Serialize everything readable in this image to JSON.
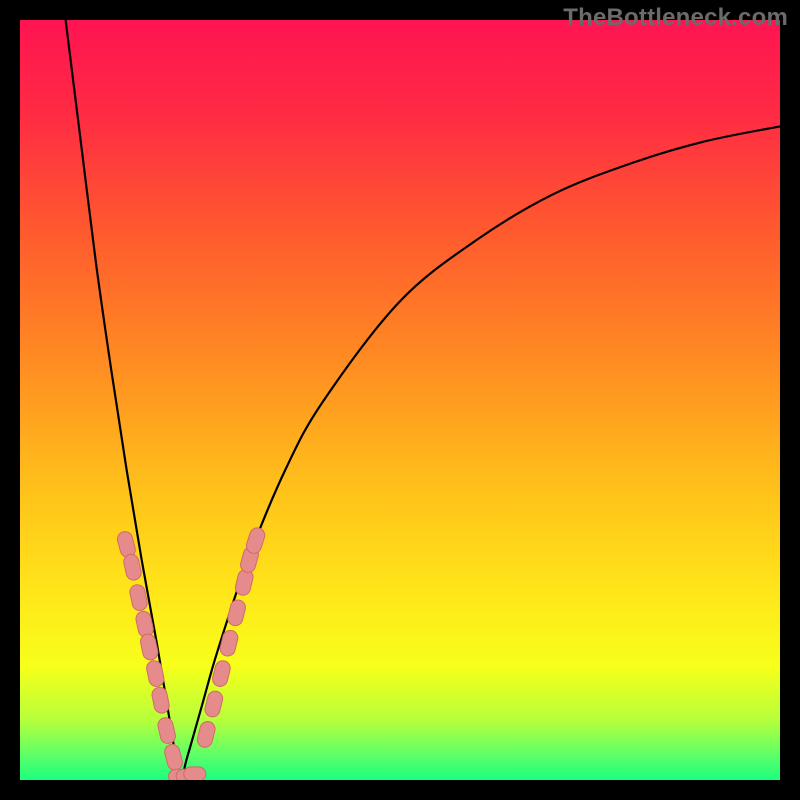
{
  "watermark_text": "TheBottleneck.com",
  "colors": {
    "frame_bg": "#000000",
    "gradient_stops": [
      {
        "offset": 0.0,
        "color": "#ff1452"
      },
      {
        "offset": 0.12,
        "color": "#ff2a44"
      },
      {
        "offset": 0.28,
        "color": "#ff5a2e"
      },
      {
        "offset": 0.45,
        "color": "#ff8c22"
      },
      {
        "offset": 0.62,
        "color": "#ffc21a"
      },
      {
        "offset": 0.76,
        "color": "#ffe81a"
      },
      {
        "offset": 0.85,
        "color": "#f7ff1a"
      },
      {
        "offset": 0.92,
        "color": "#b8ff3a"
      },
      {
        "offset": 0.97,
        "color": "#58ff6a"
      },
      {
        "offset": 1.0,
        "color": "#1aff80"
      }
    ],
    "curve_stroke": "#000000",
    "marker_fill": "#e58b8b",
    "marker_stroke": "#d06a6a"
  },
  "chart_data": {
    "type": "line",
    "title": "",
    "xlabel": "",
    "ylabel": "",
    "xlim": [
      0,
      100
    ],
    "ylim": [
      0,
      100
    ],
    "notes": "A V-shaped bottleneck curve. The minimum sits at roughly x≈21 where the value reaches ~0. Left branch is steep, right branch rises asymptotically. Pink capsule markers cluster on both branches near the valley at low y-values. Axes are unlabeled; values below are visual interpolations from the plot area (0–100 in each direction).",
    "series": [
      {
        "name": "bottleneck-curve",
        "x": [
          6,
          8,
          10,
          12,
          14,
          16,
          18,
          20,
          21,
          22,
          24,
          26,
          30,
          35,
          40,
          50,
          60,
          70,
          80,
          90,
          100
        ],
        "y": [
          100,
          84,
          68,
          54,
          41,
          29,
          18,
          6,
          0,
          3,
          10,
          17,
          29,
          41,
          50,
          63,
          71,
          77,
          81,
          84,
          86
        ]
      }
    ],
    "markers": [
      {
        "name": "left-branch-markers",
        "points": [
          {
            "x": 14.0,
            "y": 31.0
          },
          {
            "x": 14.8,
            "y": 28.0
          },
          {
            "x": 15.6,
            "y": 24.0
          },
          {
            "x": 16.4,
            "y": 20.5
          },
          {
            "x": 17.0,
            "y": 17.5
          },
          {
            "x": 17.8,
            "y": 14.0
          },
          {
            "x": 18.5,
            "y": 10.5
          },
          {
            "x": 19.3,
            "y": 6.5
          },
          {
            "x": 20.2,
            "y": 3.0
          }
        ]
      },
      {
        "name": "valley-markers",
        "points": [
          {
            "x": 21.0,
            "y": 0.5
          },
          {
            "x": 22.0,
            "y": 0.5
          },
          {
            "x": 23.0,
            "y": 0.8
          }
        ]
      },
      {
        "name": "right-branch-markers",
        "points": [
          {
            "x": 24.5,
            "y": 6.0
          },
          {
            "x": 25.5,
            "y": 10.0
          },
          {
            "x": 26.5,
            "y": 14.0
          },
          {
            "x": 27.5,
            "y": 18.0
          },
          {
            "x": 28.5,
            "y": 22.0
          },
          {
            "x": 29.5,
            "y": 26.0
          },
          {
            "x": 30.2,
            "y": 29.0
          },
          {
            "x": 31.0,
            "y": 31.5
          }
        ]
      }
    ]
  }
}
